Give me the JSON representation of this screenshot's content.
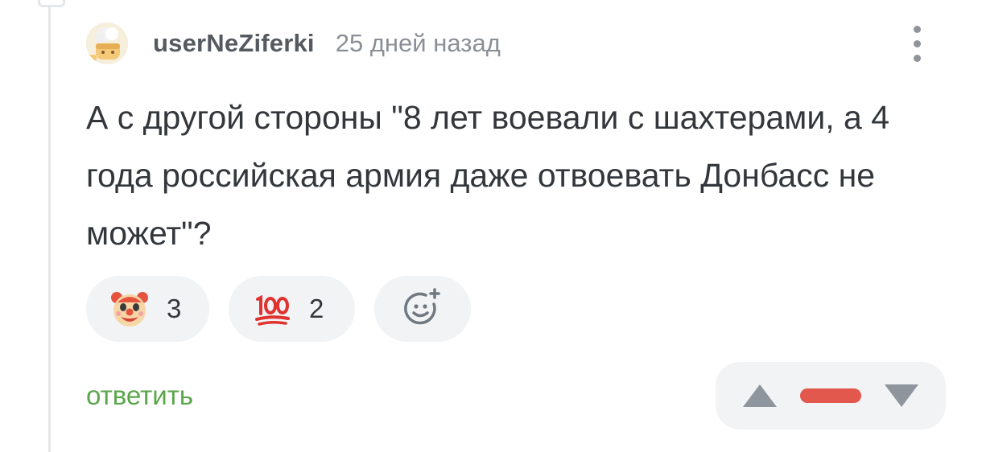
{
  "comment": {
    "author": "userNeZiferki",
    "time": "25 дней назад",
    "text": "А с другой стороны \"8 лет воевали с шахтерами, а 4 года российская армия даже отвоевать Донбасс не может\"?",
    "reactions": [
      {
        "icon": "clown-face-icon",
        "count": "3"
      },
      {
        "icon": "hundred-points-icon",
        "count": "2"
      }
    ],
    "add_reaction_icon": "add-emoji-icon",
    "reply_label": "ответить",
    "rating": {
      "status": "negative",
      "color": "#e2584d"
    }
  },
  "colors": {
    "reply_link": "#5aa64a",
    "text": "#33373c",
    "muted": "#8a8f96",
    "pill_bg": "#f1f3f5"
  }
}
